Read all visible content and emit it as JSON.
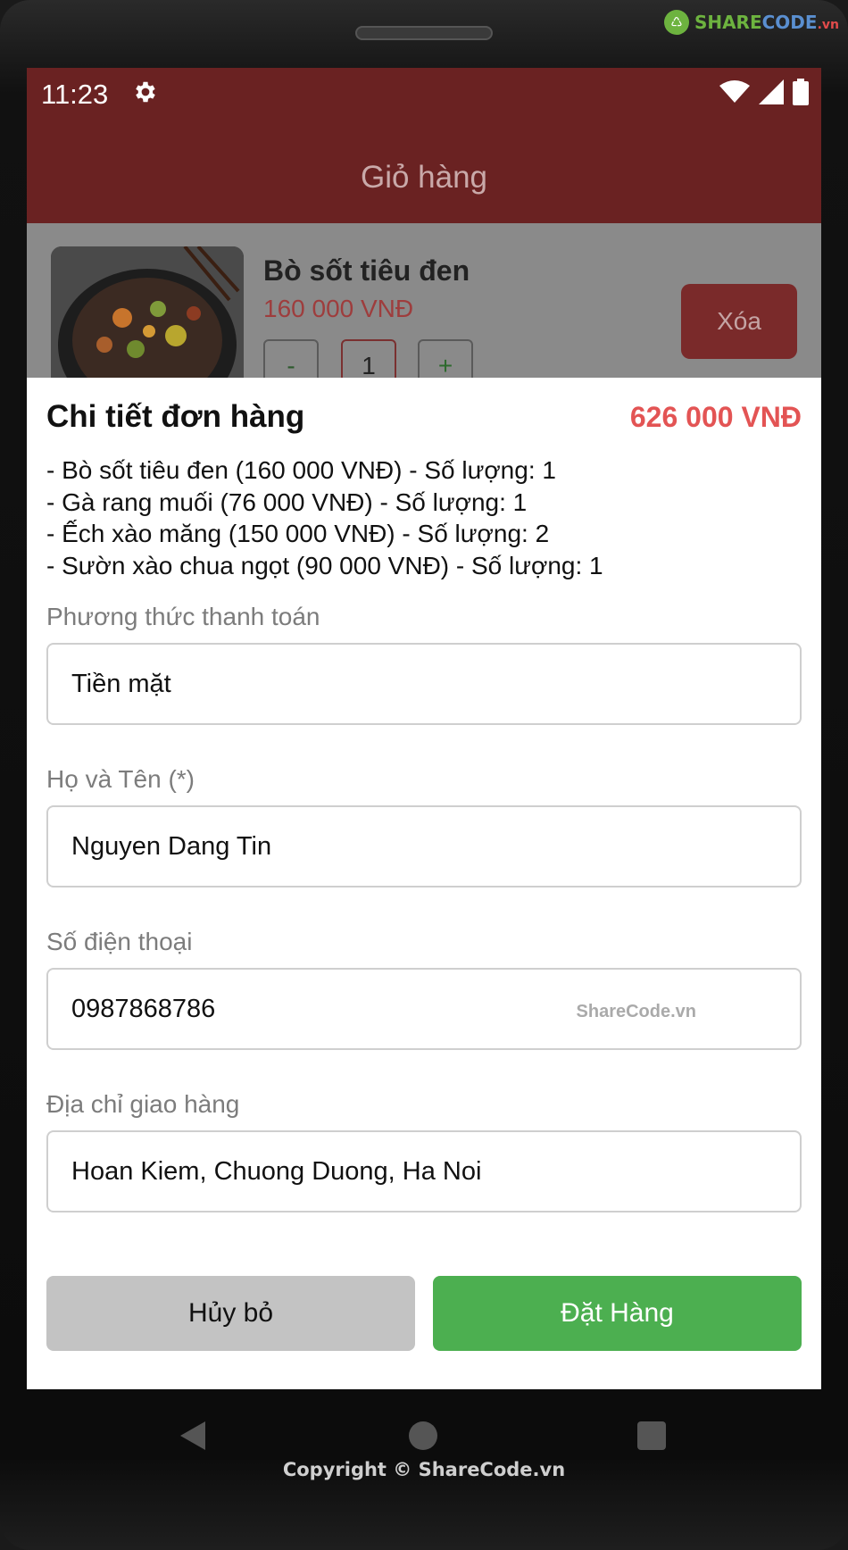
{
  "watermark": {
    "logo_share": "SHARE",
    "logo_code": "CODE",
    "logo_tld": ".vn",
    "field_watermark": "ShareCode.vn",
    "copyright": "Copyright © ShareCode.vn"
  },
  "status_bar": {
    "time": "11:23",
    "icons": [
      "gear-icon",
      "wifi-icon",
      "signal-icon",
      "battery-icon"
    ]
  },
  "app_bar": {
    "title": "Giỏ hàng"
  },
  "cart": {
    "item": {
      "name": "Bò sốt tiêu đen",
      "price": "160 000 VNĐ",
      "minus_label": "-",
      "quantity": "1",
      "plus_label": "+",
      "delete_label": "Xóa"
    }
  },
  "sheet": {
    "title": "Chi tiết đơn hàng",
    "total": "626 000 VNĐ",
    "lines": [
      "- Bò sốt tiêu đen (160 000 VNĐ) - Số lượng: 1",
      "- Gà rang muối (76 000 VNĐ) - Số lượng: 1",
      "- Ếch xào măng (150 000 VNĐ) - Số lượng: 2",
      "- Sườn xào chua ngọt (90 000 VNĐ) - Số lượng: 1"
    ],
    "payment": {
      "label": "Phương thức thanh toán",
      "value": "Tiền mặt"
    },
    "name": {
      "label": "Họ và Tên (*)",
      "value": "Nguyen Dang Tin"
    },
    "phone": {
      "label": "Số điện thoại",
      "value": "0987868786"
    },
    "address": {
      "label": "Địa chỉ giao hàng",
      "value": "Hoan Kiem, Chuong Duong, Ha Noi"
    },
    "cancel_label": "Hủy bỏ",
    "order_label": "Đặt Hàng"
  },
  "colors": {
    "app_bar": "#6a2222",
    "total": "#e35454",
    "order_button": "#4caf50",
    "cancel_button": "#c3c3c3"
  }
}
